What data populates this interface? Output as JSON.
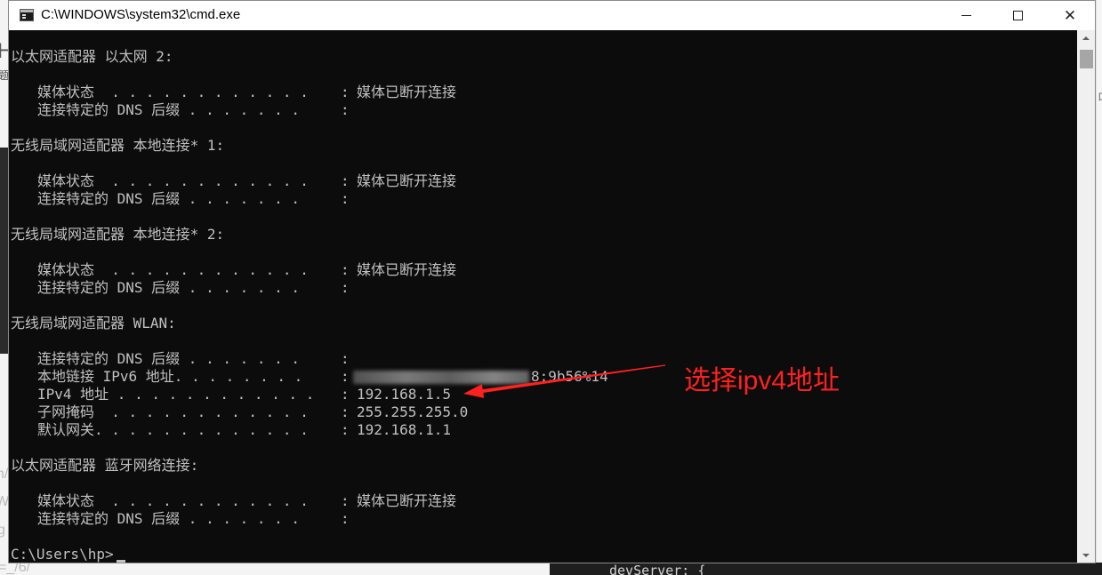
{
  "window": {
    "title": "C:\\WINDOWS\\system32\\cmd.exe",
    "app_icon": "cmd-icon",
    "controls": {
      "minimize_icon": "minimize-icon",
      "maximize_icon": "maximize-icon",
      "close_icon": "close-icon",
      "close_glyph": "✕"
    }
  },
  "console": {
    "lines": [
      {
        "kind": "header",
        "text": "以太网适配器 以太网 2:"
      },
      {
        "kind": "blank"
      },
      {
        "kind": "entry",
        "label": "媒体状态  . . . . . . . . . . . .",
        "colon": ":",
        "value": "媒体已断开连接"
      },
      {
        "kind": "entry",
        "label": "连接特定的 DNS 后缀 . . . . . . .",
        "colon": ":",
        "value": ""
      },
      {
        "kind": "blank"
      },
      {
        "kind": "header",
        "text": "无线局域网适配器 本地连接* 1:"
      },
      {
        "kind": "blank"
      },
      {
        "kind": "entry",
        "label": "媒体状态  . . . . . . . . . . . .",
        "colon": ":",
        "value": "媒体已断开连接"
      },
      {
        "kind": "entry",
        "label": "连接特定的 DNS 后缀 . . . . . . .",
        "colon": ":",
        "value": ""
      },
      {
        "kind": "blank"
      },
      {
        "kind": "header",
        "text": "无线局域网适配器 本地连接* 2:"
      },
      {
        "kind": "blank"
      },
      {
        "kind": "entry",
        "label": "媒体状态  . . . . . . . . . . . .",
        "colon": ":",
        "value": "媒体已断开连接"
      },
      {
        "kind": "entry",
        "label": "连接特定的 DNS 后缀 . . . . . . .",
        "colon": ":",
        "value": ""
      },
      {
        "kind": "blank"
      },
      {
        "kind": "header",
        "text": "无线局域网适配器 WLAN:"
      },
      {
        "kind": "blank"
      },
      {
        "kind": "entry",
        "label": "连接特定的 DNS 后缀 . . . . . . .",
        "colon": ":",
        "value": ""
      },
      {
        "kind": "entry",
        "label": "本地链接 IPv6 地址. . . . . . . .",
        "colon": ":",
        "value": "8:9b56%14",
        "redacted": true
      },
      {
        "kind": "entry",
        "label": "IPv4 地址 . . . . . . . . . . . .",
        "colon": ":",
        "value": "192.168.1.5"
      },
      {
        "kind": "entry",
        "label": "子网掩码  . . . . . . . . . . . .",
        "colon": ":",
        "value": "255.255.255.0"
      },
      {
        "kind": "entry",
        "label": "默认网关. . . . . . . . . . . . .",
        "colon": ":",
        "value": "192.168.1.1"
      },
      {
        "kind": "blank"
      },
      {
        "kind": "header",
        "text": "以太网适配器 蓝牙网络连接:"
      },
      {
        "kind": "blank"
      },
      {
        "kind": "entry",
        "label": "媒体状态  . . . . . . . . . . . .",
        "colon": ":",
        "value": "媒体已断开连接"
      },
      {
        "kind": "entry",
        "label": "连接特定的 DNS 后缀 . . . . . . .",
        "colon": ":",
        "value": ""
      },
      {
        "kind": "blank"
      },
      {
        "kind": "prompt",
        "text": "C:\\Users\\hp>"
      }
    ],
    "colors": {
      "background": "#0c0c0c",
      "text": "#c0c0c0"
    }
  },
  "annotation": {
    "text": "选择ipv4地址",
    "color": "#ff2020",
    "arrow_icon": "red-arrow-icon"
  },
  "backdrop": {
    "left_fragments": [
      "H",
      "题",
      "n/",
      "W",
      "g",
      "=_/6/"
    ],
    "right_fragments": [
      "ロ"
    ],
    "editor_text": "devServer: {"
  }
}
